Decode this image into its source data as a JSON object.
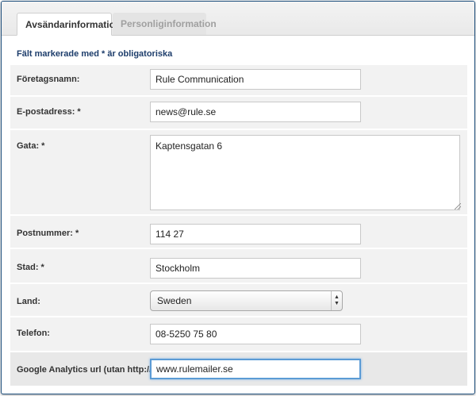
{
  "tabs": [
    {
      "label": "Avsändarinformation",
      "active": true
    },
    {
      "label": "Personliginformation",
      "active": false
    }
  ],
  "required_note": "Fält markerade med * är obligatoriska",
  "fields": {
    "company": {
      "label": "Företagsnamn:",
      "value": "Rule Communication"
    },
    "email": {
      "label": "E-postadress: *",
      "value": "news@rule.se"
    },
    "street": {
      "label": "Gata: *",
      "value": "Kaptensgatan 6"
    },
    "postcode": {
      "label": "Postnummer: *",
      "value": "114 27"
    },
    "city": {
      "label": "Stad: *",
      "value": "Stockholm"
    },
    "country": {
      "label": "Land:",
      "value": "Sweden"
    },
    "phone": {
      "label": "Telefon:",
      "value": "08-5250 75 80"
    },
    "analytics": {
      "label": "Google Analytics url (utan http://):",
      "value": "www.rulemailer.se"
    }
  },
  "colors": {
    "accent": "#1d4e7c",
    "focus": "#5b9bd5",
    "row_bg": "#f2f2f2"
  }
}
